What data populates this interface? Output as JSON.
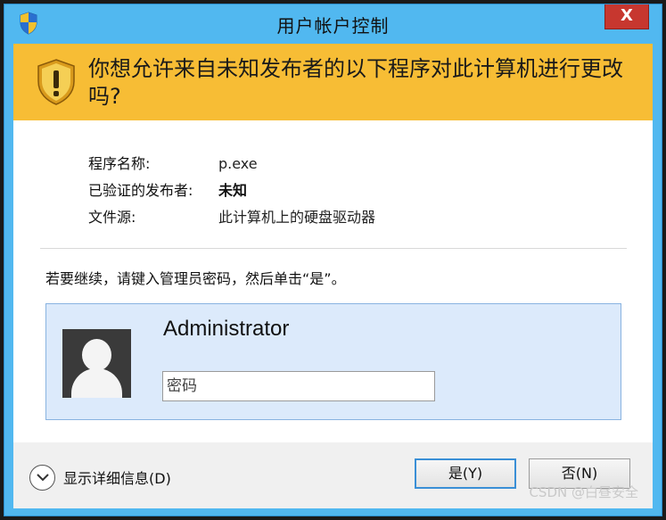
{
  "window": {
    "title": "用户帐户控制",
    "close_label": "X",
    "title_icon": "uac-shield-icon"
  },
  "warning": {
    "icon": "warning-shield-icon",
    "text": "你想允许来自未知发布者的以下程序对此计算机进行更改吗?"
  },
  "info": {
    "rows": [
      {
        "label": "程序名称:",
        "value": "p.exe"
      },
      {
        "label": "已验证的发布者:",
        "value": "未知"
      },
      {
        "label": "文件源:",
        "value": "此计算机上的硬盘驱动器"
      }
    ]
  },
  "instruction": "若要继续，请键入管理员密码，然后单击“是”。",
  "credentials": {
    "username": "Administrator",
    "password_placeholder": "密码",
    "password_value": ""
  },
  "footer": {
    "details_label": "显示详细信息(D)",
    "yes_label": "是(Y)",
    "no_label": "否(N)"
  },
  "watermark": "CSDN @白昼安全",
  "colors": {
    "titlebar": "#51b8f0",
    "warning_band": "#f7bd35",
    "credential_panel": "#dceafb",
    "close_button": "#c7372f",
    "footer": "#f0f0f0"
  }
}
